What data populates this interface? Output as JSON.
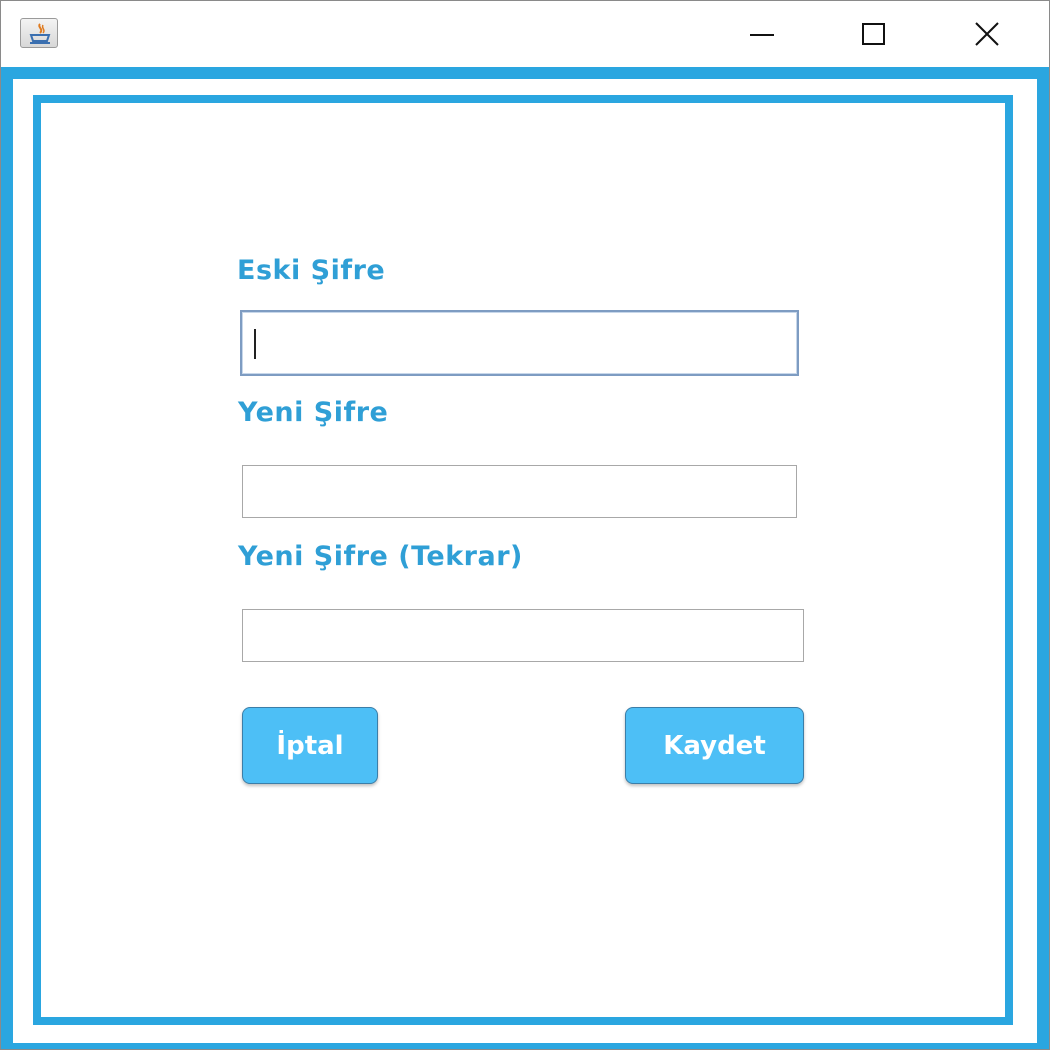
{
  "window": {
    "title": "",
    "controls": {
      "minimize_icon": "minimize-icon",
      "maximize_icon": "maximize-icon",
      "close_icon": "close-icon"
    }
  },
  "form": {
    "old_password": {
      "label": "Eski Şifre",
      "value": ""
    },
    "new_password": {
      "label": "Yeni Şifre",
      "value": ""
    },
    "new_password_repeat": {
      "label": "Yeni Şifre (Tekrar)",
      "value": ""
    }
  },
  "buttons": {
    "cancel_label": "İptal",
    "save_label": "Kaydet"
  },
  "colors": {
    "accent": "#2aa6e0",
    "label": "#2f9fd6",
    "button": "#4dbff6"
  }
}
